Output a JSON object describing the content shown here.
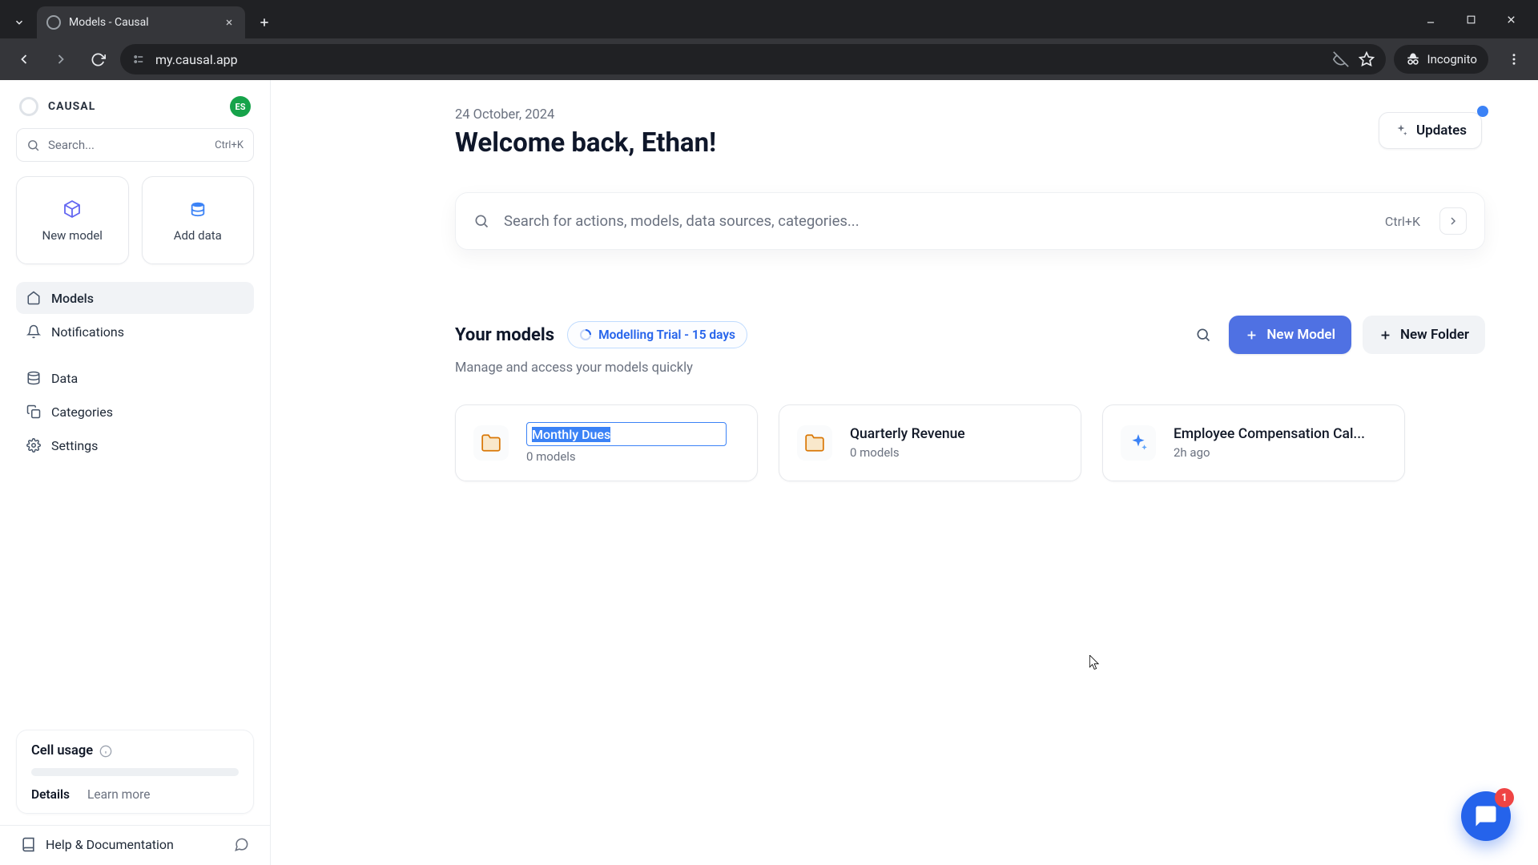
{
  "browser": {
    "tab_title": "Models - Causal",
    "url": "my.causal.app",
    "incognito_label": "Incognito"
  },
  "sidebar": {
    "brand": "CAUSAL",
    "avatar_initials": "ES",
    "search_placeholder": "Search...",
    "search_shortcut": "Ctrl+K",
    "quick": {
      "new_model": "New model",
      "add_data": "Add data"
    },
    "nav": {
      "models": "Models",
      "notifications": "Notifications",
      "data": "Data",
      "categories": "Categories",
      "settings": "Settings"
    },
    "usage": {
      "title": "Cell usage",
      "details": "Details",
      "learn": "Learn more"
    },
    "help_label": "Help & Documentation"
  },
  "header": {
    "date": "24 October, 2024",
    "welcome": "Welcome back, Ethan!",
    "updates_label": "Updates"
  },
  "search": {
    "placeholder": "Search for actions, models, data sources, categories...",
    "shortcut": "Ctrl+K"
  },
  "models": {
    "title": "Your models",
    "trial_label": "Modelling Trial - 15 days",
    "subtitle": "Manage and access your models quickly",
    "new_model_btn": "New Model",
    "new_folder_btn": "New Folder",
    "cards": [
      {
        "type": "folder",
        "title": "Monthly Dues",
        "sub": "0 models",
        "editing": true
      },
      {
        "type": "folder",
        "title": "Quarterly Revenue",
        "sub": "0 models",
        "editing": false
      },
      {
        "type": "model",
        "title": "Employee Compensation Cal...",
        "sub": "2h ago",
        "editing": false
      }
    ]
  },
  "chat": {
    "badge": "1"
  }
}
